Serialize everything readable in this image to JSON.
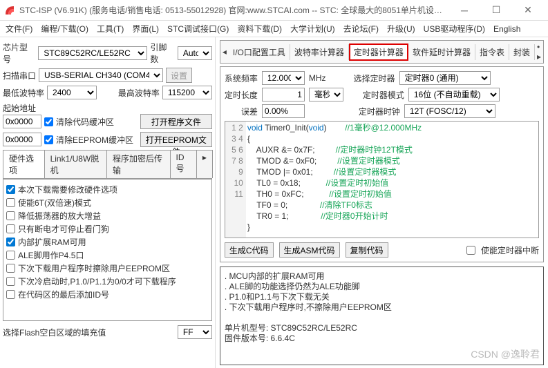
{
  "title": "STC-ISP (V6.91K) (服务电话/销售电话: 0513-55012928) 官网:www.STCAI.com  -- STC: 全球最大的8051单片机设…",
  "menus": [
    "文件(F)",
    "编程/下载(O)",
    "工具(T)",
    "界面(L)",
    "STC调试接口(G)",
    "资料下载(D)",
    "大学计划(U)",
    "去论坛(F)",
    "升级(U)",
    "USB驱动程序(D)",
    "English"
  ],
  "left": {
    "chip_label": "芯片型号",
    "chip_value": "STC89C52RC/LE52RC",
    "pin_label": "引脚数",
    "pin_value": "Auto",
    "port_label": "扫描串口",
    "port_value": "USB-SERIAL CH340 (COM43)",
    "port_btn": "设置",
    "minbaud_label": "最低波特率",
    "minbaud": "2400",
    "maxbaud_label": "最高波特率",
    "maxbaud": "115200",
    "addr_label": "起始地址",
    "addr1": "0x0000",
    "clr1": "清除代码缓冲区",
    "btn1": "打开程序文件",
    "addr2": "0x0000",
    "clr2": "清除EEPROM缓冲区",
    "btn2": "打开EEPROM文件",
    "tabs": [
      "硬件选项",
      "Link1/U8W脱机",
      "程序加密后传输",
      "ID号"
    ],
    "checks": [
      {
        "c": true,
        "t": "本次下载需要修改硬件选项"
      },
      {
        "c": false,
        "t": "使能6T(双倍速)模式"
      },
      {
        "c": false,
        "t": "降低振荡器的放大增益"
      },
      {
        "c": false,
        "t": "只有断电才可停止看门狗"
      },
      {
        "c": true,
        "t": "内部扩展RAM可用"
      },
      {
        "c": false,
        "t": "ALE脚用作P4.5口"
      },
      {
        "c": false,
        "t": "下次下载用户程序时擦除用户EEPROM区"
      },
      {
        "c": false,
        "t": "下次冷启动时,P1.0/P1.1为0/0才可下载程序"
      },
      {
        "c": false,
        "t": "在代码区的最后添加ID号"
      }
    ],
    "flash_label": "选择Flash空白区域的填充值",
    "flash_val": "FF"
  },
  "right": {
    "tabs": [
      "I/O口配置工具",
      "波特率计算器",
      "定时器计算器",
      "软件延时计算器",
      "指令表",
      "封装"
    ],
    "active_idx": 2,
    "sysfreq_l": "系统频率",
    "sysfreq_v": "12.000",
    "sysfreq_u": "MHz",
    "selt_l": "选择定时器",
    "selt_v": "定时器0 (通用)",
    "tlen_l": "定时长度",
    "tlen_v": "1",
    "tlen_u": "毫秒",
    "tmode_l": "定时器模式",
    "tmode_v": "16位 (不自动重载)",
    "err_l": "误差",
    "err_v": "0.00%",
    "tclk_l": "定时器时钟",
    "tclk_v": "12T (FOSC/12)",
    "code": [
      {
        "n": 1,
        "a": "void",
        "b": " Timer0_Init(",
        "c": "void",
        "d": ")",
        "cm": "//1毫秒@12.000MHz"
      },
      {
        "n": 2,
        "t": "{"
      },
      {
        "n": 3,
        "t": "    AUXR &= 0x7F;",
        "cm": "//定时器时钟12T模式"
      },
      {
        "n": 4,
        "t": "    TMOD &= 0xF0;",
        "cm": "//设置定时器模式"
      },
      {
        "n": 5,
        "t": "    TMOD |= 0x01;",
        "cm": "//设置定时器模式"
      },
      {
        "n": 6,
        "t": "    TL0 = 0x18;",
        "cm": "//设置定时初始值"
      },
      {
        "n": 7,
        "t": "    TH0 = 0xFC;",
        "cm": "//设置定时初始值"
      },
      {
        "n": 8,
        "t": "    TF0 = 0;",
        "cm": "//清除TF0标志"
      },
      {
        "n": 9,
        "t": "    TR0 = 1;",
        "cm": "//定时器0开始计时"
      },
      {
        "n": 10,
        "t": "}"
      },
      {
        "n": 11,
        "t": ""
      }
    ],
    "btns": [
      "生成C代码",
      "生成ASM代码",
      "复制代码"
    ],
    "enable_int": "使能定时器中断",
    "log": ". MCU内部的扩展RAM可用\n. ALE脚的功能选择仍然为ALE功能脚\n. P1.0和P1.1与下次下载无关\n. 下次下载用户程序时,不擦除用户EEPROM区\n\n单片机型号: STC89C52RC/LE52RC\n固件版本号: 6.6.4C"
  },
  "watermark": "CSDN @逸聆君"
}
